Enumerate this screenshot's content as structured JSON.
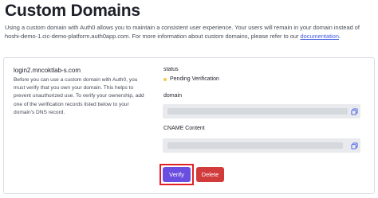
{
  "page": {
    "title": "Custom Domains",
    "intro_text": "Using a custom domain with Auth0 allows you to maintain a consistent user experience. Your users will remain in your domain instead of hoshi-demo-1.cic-demo-platform.auth0app.com. For more information about custom domains, please refer to our ",
    "intro_link": "documentation",
    "intro_end": "."
  },
  "domain": {
    "name": "login2.mncoktlab-s.com",
    "description": "Before you can use a custom domain with Auth0, you must verify that you own your domain. This helps to prevent unauthorized use. To verify your ownership, add one of the verification records listed below to your domain's DNS record."
  },
  "status": {
    "label": "status",
    "value": "Pending Verification",
    "color": "#f2c94c"
  },
  "fields": {
    "domain_label": "domain",
    "cname_label": "CNAME Content"
  },
  "actions": {
    "verify_label": "Verify",
    "delete_label": "Delete"
  },
  "colors": {
    "verify": "#6a4ee0",
    "delete": "#d13b3b",
    "highlight": "#e01f26",
    "link": "#3f59e4"
  },
  "icons": [
    "copy-icon"
  ]
}
